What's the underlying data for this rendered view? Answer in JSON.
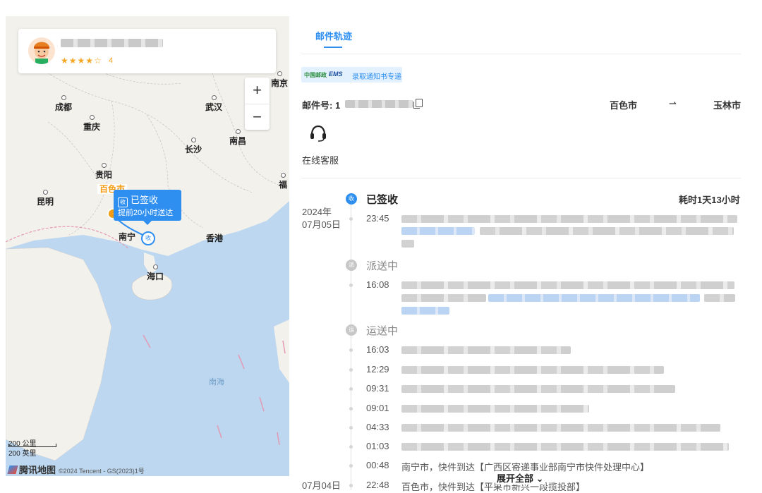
{
  "map": {
    "courier": {
      "name": "",
      "stars": "★★★★☆",
      "rating": "4"
    },
    "zoom": {
      "in": "+",
      "out": "−"
    },
    "cities": {
      "chengdu": "成都",
      "chongqing": "重庆",
      "wuhan": "武汉",
      "nanjing": "南京",
      "nanchang": "南昌",
      "changsha": "长沙",
      "guiyang": "贵阳",
      "kunming": "昆明",
      "baise": "百色市",
      "nanning": "南宁",
      "hongkong": "香港",
      "haikou": "海口",
      "fuzhou": "福",
      "nanhai": "南海"
    },
    "popup": {
      "icon": "收",
      "status": "已签收",
      "note": "提前20小时送达"
    },
    "pin_icon": "收",
    "scale_km": "200 公里",
    "scale_mi": "200 英里",
    "brand": "腾讯地图",
    "copyright": "©2024 Tencent - GS(2023)1号"
  },
  "panel": {
    "tab_label": "邮件轨迹",
    "banner": {
      "post": "中国邮政",
      "ems": "EMS",
      "text": "录取通知书专递"
    },
    "tracking_label": "邮件号:",
    "tracking_prefix": "1",
    "tracking_number": "",
    "from_city": "百色市",
    "route_arrow": "⇀",
    "to_city": "玉林市",
    "service_label": "在线客服",
    "elapsed": "耗时1天13小时",
    "expand_label": "展开全部 ⌄"
  },
  "timeline": {
    "date1": {
      "year": "2024年",
      "day": "07月05日"
    },
    "date2": "07月04日",
    "statuses": [
      {
        "icon": "收",
        "label": "已签收"
      },
      {
        "icon": "派",
        "label": "派送中"
      },
      {
        "icon": "运",
        "label": "运送中"
      }
    ],
    "events": [
      {
        "time": "23:45",
        "text": ""
      },
      {
        "time": "16:08",
        "text": ""
      },
      {
        "time": "16:03",
        "text": ""
      },
      {
        "time": "12:29",
        "text": ""
      },
      {
        "time": "09:31",
        "text": ""
      },
      {
        "time": "09:01",
        "text": ""
      },
      {
        "time": "04:33",
        "text": ""
      },
      {
        "time": "01:03",
        "text": ""
      },
      {
        "time": "00:48",
        "text": "南宁市，快件到达【广西区寄递事业部南宁市快件处理中心】"
      },
      {
        "time": "22:48",
        "text": "百色市，快件到达【平果市新兴一段揽投部】"
      }
    ]
  }
}
